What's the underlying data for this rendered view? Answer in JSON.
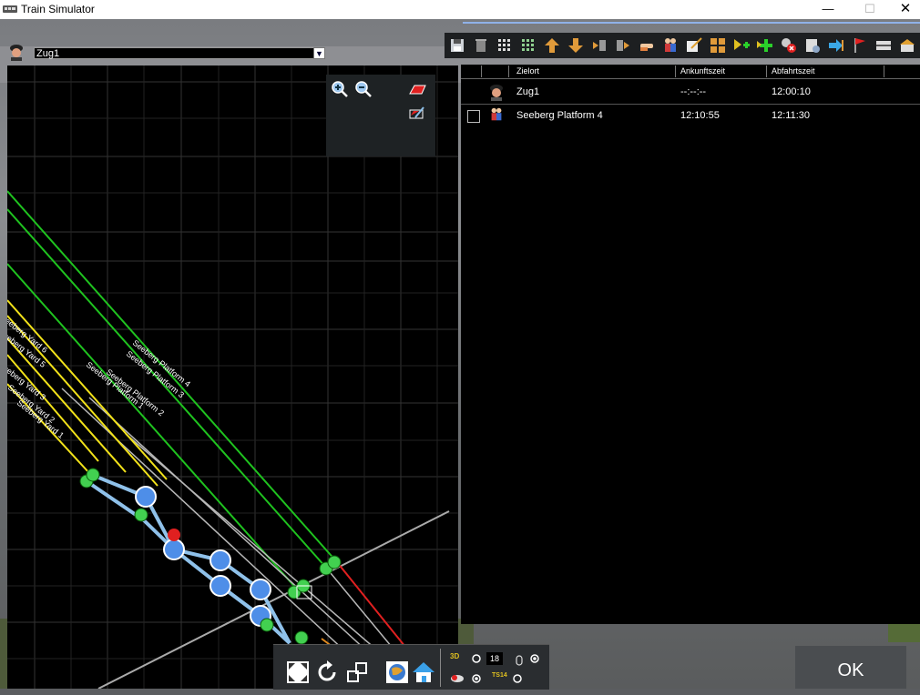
{
  "window": {
    "title": "Train Simulator",
    "minimize": "—",
    "maximize": "☐",
    "close": "✕"
  },
  "train_selector": {
    "selected": "Zug1"
  },
  "schedule": {
    "columns": [
      "Zielort",
      "Ankunftszeit",
      "Abfahrtszeit"
    ],
    "rows": [
      {
        "icon": "driver-icon",
        "destination": "Zug1",
        "arrival": "--:--:--",
        "departure": "12:00:10"
      },
      {
        "icon": "passengers-icon",
        "destination": "Seeberg Platform 4",
        "arrival": "12:10:55",
        "departure": "12:11:30"
      }
    ]
  },
  "map": {
    "track_labels": [
      "Seeberg Platform 4",
      "Seeberg Platform 3",
      "Seeberg Platform 2",
      "Seeberg Platform 1",
      "Seeberg Yard 6",
      "Seeberg Yard 5",
      "Seeberg Yard 3",
      "Seeberg Yard 2",
      "Seeberg Yard 1"
    ]
  },
  "bottom_toolbar": {
    "sliders": {
      "value_box": "18",
      "label_top": "3D",
      "label_bottom": "TS14"
    }
  },
  "ok_label": "OK",
  "colors": {
    "platform_track": "#1fc31f",
    "yard_track": "#f2e21a",
    "route": "#8fc1ea",
    "signal_red": "#e02020",
    "node": "#4e8ee8"
  }
}
